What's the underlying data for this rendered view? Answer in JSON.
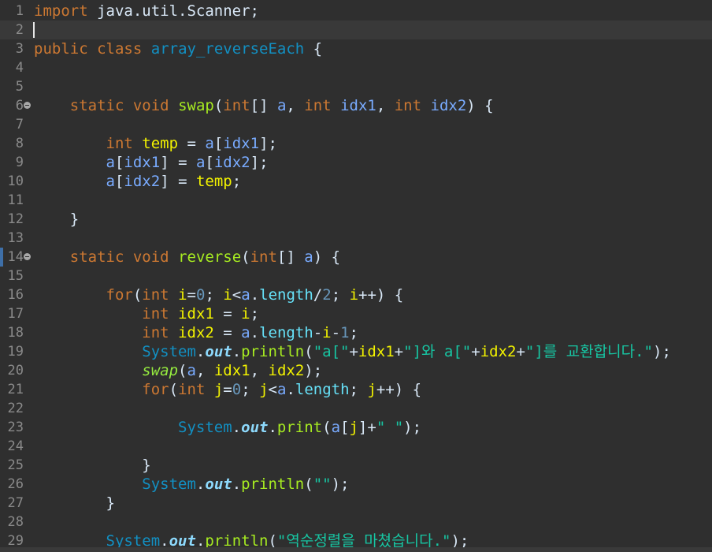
{
  "editor": {
    "current_line": 2,
    "lines": [
      {
        "n": "1",
        "tokens": [
          {
            "t": "import",
            "c": "kw"
          },
          {
            "t": " java.util.Scanner;",
            "c": "pl"
          }
        ]
      },
      {
        "n": "2",
        "tokens": []
      },
      {
        "n": "3",
        "tokens": [
          {
            "t": "public",
            "c": "kw"
          },
          {
            "t": " ",
            "c": "pl"
          },
          {
            "t": "class",
            "c": "kw"
          },
          {
            "t": " ",
            "c": "pl"
          },
          {
            "t": "array_reverseEach",
            "c": "cls"
          },
          {
            "t": " {",
            "c": "pl"
          }
        ]
      },
      {
        "n": "4",
        "tokens": []
      },
      {
        "n": "5",
        "tokens": []
      },
      {
        "n": "6",
        "fold": true,
        "tokens": [
          {
            "t": "    ",
            "c": "pl"
          },
          {
            "t": "static",
            "c": "kw"
          },
          {
            "t": " ",
            "c": "pl"
          },
          {
            "t": "void",
            "c": "kw"
          },
          {
            "t": " ",
            "c": "pl"
          },
          {
            "t": "swap",
            "c": "fn"
          },
          {
            "t": "(",
            "c": "pl"
          },
          {
            "t": "int",
            "c": "kw"
          },
          {
            "t": "[] ",
            "c": "pl"
          },
          {
            "t": "a",
            "c": "var"
          },
          {
            "t": ", ",
            "c": "pl"
          },
          {
            "t": "int",
            "c": "kw"
          },
          {
            "t": " ",
            "c": "pl"
          },
          {
            "t": "idx1",
            "c": "var"
          },
          {
            "t": ", ",
            "c": "pl"
          },
          {
            "t": "int",
            "c": "kw"
          },
          {
            "t": " ",
            "c": "pl"
          },
          {
            "t": "idx2",
            "c": "var"
          },
          {
            "t": ") {",
            "c": "pl"
          }
        ]
      },
      {
        "n": "7",
        "tokens": []
      },
      {
        "n": "8",
        "tokens": [
          {
            "t": "        ",
            "c": "pl"
          },
          {
            "t": "int",
            "c": "kw"
          },
          {
            "t": " ",
            "c": "pl"
          },
          {
            "t": "temp",
            "c": "loc"
          },
          {
            "t": " = ",
            "c": "pl"
          },
          {
            "t": "a",
            "c": "var"
          },
          {
            "t": "[",
            "c": "pl"
          },
          {
            "t": "idx1",
            "c": "var"
          },
          {
            "t": "];",
            "c": "pl"
          }
        ]
      },
      {
        "n": "9",
        "tokens": [
          {
            "t": "        ",
            "c": "pl"
          },
          {
            "t": "a",
            "c": "var"
          },
          {
            "t": "[",
            "c": "pl"
          },
          {
            "t": "idx1",
            "c": "var"
          },
          {
            "t": "] = ",
            "c": "pl"
          },
          {
            "t": "a",
            "c": "var"
          },
          {
            "t": "[",
            "c": "pl"
          },
          {
            "t": "idx2",
            "c": "var"
          },
          {
            "t": "];",
            "c": "pl"
          }
        ]
      },
      {
        "n": "10",
        "tokens": [
          {
            "t": "        ",
            "c": "pl"
          },
          {
            "t": "a",
            "c": "var"
          },
          {
            "t": "[",
            "c": "pl"
          },
          {
            "t": "idx2",
            "c": "var"
          },
          {
            "t": "] = ",
            "c": "pl"
          },
          {
            "t": "temp",
            "c": "loc"
          },
          {
            "t": ";",
            "c": "pl"
          }
        ]
      },
      {
        "n": "11",
        "tokens": []
      },
      {
        "n": "12",
        "tokens": [
          {
            "t": "    }",
            "c": "pl"
          }
        ]
      },
      {
        "n": "13",
        "tokens": []
      },
      {
        "n": "14",
        "fold": true,
        "marker": true,
        "tokens": [
          {
            "t": "    ",
            "c": "pl"
          },
          {
            "t": "static",
            "c": "kw"
          },
          {
            "t": " ",
            "c": "pl"
          },
          {
            "t": "void",
            "c": "kw"
          },
          {
            "t": " ",
            "c": "pl"
          },
          {
            "t": "reverse",
            "c": "fn"
          },
          {
            "t": "(",
            "c": "pl"
          },
          {
            "t": "int",
            "c": "kw"
          },
          {
            "t": "[] ",
            "c": "pl"
          },
          {
            "t": "a",
            "c": "var"
          },
          {
            "t": ") {",
            "c": "pl"
          }
        ]
      },
      {
        "n": "15",
        "tokens": []
      },
      {
        "n": "16",
        "tokens": [
          {
            "t": "        ",
            "c": "pl"
          },
          {
            "t": "for",
            "c": "kw"
          },
          {
            "t": "(",
            "c": "pl"
          },
          {
            "t": "int",
            "c": "kw"
          },
          {
            "t": " ",
            "c": "pl"
          },
          {
            "t": "i",
            "c": "loc"
          },
          {
            "t": "=",
            "c": "pl"
          },
          {
            "t": "0",
            "c": "num"
          },
          {
            "t": "; ",
            "c": "pl"
          },
          {
            "t": "i",
            "c": "loc"
          },
          {
            "t": "<",
            "c": "pl"
          },
          {
            "t": "a",
            "c": "var"
          },
          {
            "t": ".",
            "c": "pl"
          },
          {
            "t": "length",
            "c": "fld"
          },
          {
            "t": "/",
            "c": "pl"
          },
          {
            "t": "2",
            "c": "num"
          },
          {
            "t": "; ",
            "c": "pl"
          },
          {
            "t": "i",
            "c": "loc"
          },
          {
            "t": "++) {",
            "c": "pl"
          }
        ]
      },
      {
        "n": "17",
        "tokens": [
          {
            "t": "            ",
            "c": "pl"
          },
          {
            "t": "int",
            "c": "kw"
          },
          {
            "t": " ",
            "c": "pl"
          },
          {
            "t": "idx1",
            "c": "loc"
          },
          {
            "t": " = ",
            "c": "pl"
          },
          {
            "t": "i",
            "c": "loc"
          },
          {
            "t": ";",
            "c": "pl"
          }
        ]
      },
      {
        "n": "18",
        "tokens": [
          {
            "t": "            ",
            "c": "pl"
          },
          {
            "t": "int",
            "c": "kw"
          },
          {
            "t": " ",
            "c": "pl"
          },
          {
            "t": "idx2",
            "c": "loc"
          },
          {
            "t": " = ",
            "c": "pl"
          },
          {
            "t": "a",
            "c": "var"
          },
          {
            "t": ".",
            "c": "pl"
          },
          {
            "t": "length",
            "c": "fld"
          },
          {
            "t": "-",
            "c": "pl"
          },
          {
            "t": "i",
            "c": "loc"
          },
          {
            "t": "-",
            "c": "pl"
          },
          {
            "t": "1",
            "c": "num"
          },
          {
            "t": ";",
            "c": "pl"
          }
        ]
      },
      {
        "n": "19",
        "tokens": [
          {
            "t": "            ",
            "c": "pl"
          },
          {
            "t": "System",
            "c": "sys"
          },
          {
            "t": ".",
            "c": "pl"
          },
          {
            "t": "out",
            "c": "out"
          },
          {
            "t": ".",
            "c": "pl"
          },
          {
            "t": "println",
            "c": "mcall"
          },
          {
            "t": "(",
            "c": "pl"
          },
          {
            "t": "\"a[\"",
            "c": "str"
          },
          {
            "t": "+",
            "c": "pl"
          },
          {
            "t": "idx1",
            "c": "loc"
          },
          {
            "t": "+",
            "c": "pl"
          },
          {
            "t": "\"]와 a[\"",
            "c": "str"
          },
          {
            "t": "+",
            "c": "pl"
          },
          {
            "t": "idx2",
            "c": "loc"
          },
          {
            "t": "+",
            "c": "pl"
          },
          {
            "t": "\"]를 교환합니다.\"",
            "c": "str"
          },
          {
            "t": ");",
            "c": "pl"
          }
        ]
      },
      {
        "n": "20",
        "tokens": [
          {
            "t": "            ",
            "c": "pl"
          },
          {
            "t": "swap",
            "c": "mstatic"
          },
          {
            "t": "(",
            "c": "pl"
          },
          {
            "t": "a",
            "c": "var"
          },
          {
            "t": ", ",
            "c": "pl"
          },
          {
            "t": "idx1",
            "c": "loc"
          },
          {
            "t": ", ",
            "c": "pl"
          },
          {
            "t": "idx2",
            "c": "loc"
          },
          {
            "t": ");",
            "c": "pl"
          }
        ]
      },
      {
        "n": "21",
        "tokens": [
          {
            "t": "            ",
            "c": "pl"
          },
          {
            "t": "for",
            "c": "kw"
          },
          {
            "t": "(",
            "c": "pl"
          },
          {
            "t": "int",
            "c": "kw"
          },
          {
            "t": " ",
            "c": "pl"
          },
          {
            "t": "j",
            "c": "loc"
          },
          {
            "t": "=",
            "c": "pl"
          },
          {
            "t": "0",
            "c": "num"
          },
          {
            "t": "; ",
            "c": "pl"
          },
          {
            "t": "j",
            "c": "loc"
          },
          {
            "t": "<",
            "c": "pl"
          },
          {
            "t": "a",
            "c": "var"
          },
          {
            "t": ".",
            "c": "pl"
          },
          {
            "t": "length",
            "c": "fld"
          },
          {
            "t": "; ",
            "c": "pl"
          },
          {
            "t": "j",
            "c": "loc"
          },
          {
            "t": "++) {",
            "c": "pl"
          }
        ]
      },
      {
        "n": "22",
        "tokens": []
      },
      {
        "n": "23",
        "tokens": [
          {
            "t": "                ",
            "c": "pl"
          },
          {
            "t": "System",
            "c": "sys"
          },
          {
            "t": ".",
            "c": "pl"
          },
          {
            "t": "out",
            "c": "out"
          },
          {
            "t": ".",
            "c": "pl"
          },
          {
            "t": "print",
            "c": "mcall"
          },
          {
            "t": "(",
            "c": "pl"
          },
          {
            "t": "a",
            "c": "var"
          },
          {
            "t": "[",
            "c": "pl"
          },
          {
            "t": "j",
            "c": "loc"
          },
          {
            "t": "]+",
            "c": "pl"
          },
          {
            "t": "\" \"",
            "c": "str"
          },
          {
            "t": ");",
            "c": "pl"
          }
        ]
      },
      {
        "n": "24",
        "tokens": []
      },
      {
        "n": "25",
        "tokens": [
          {
            "t": "            }",
            "c": "pl"
          }
        ]
      },
      {
        "n": "26",
        "tokens": [
          {
            "t": "            ",
            "c": "pl"
          },
          {
            "t": "System",
            "c": "sys"
          },
          {
            "t": ".",
            "c": "pl"
          },
          {
            "t": "out",
            "c": "out"
          },
          {
            "t": ".",
            "c": "pl"
          },
          {
            "t": "println",
            "c": "mcall"
          },
          {
            "t": "(",
            "c": "pl"
          },
          {
            "t": "\"\"",
            "c": "str"
          },
          {
            "t": ");",
            "c": "pl"
          }
        ]
      },
      {
        "n": "27",
        "tokens": [
          {
            "t": "        }",
            "c": "pl"
          }
        ]
      },
      {
        "n": "28",
        "tokens": []
      },
      {
        "n": "29",
        "tokens": [
          {
            "t": "        ",
            "c": "pl"
          },
          {
            "t": "System",
            "c": "sys"
          },
          {
            "t": ".",
            "c": "pl"
          },
          {
            "t": "out",
            "c": "out"
          },
          {
            "t": ".",
            "c": "pl"
          },
          {
            "t": "println",
            "c": "mcall"
          },
          {
            "t": "(",
            "c": "pl"
          },
          {
            "t": "\"역순정렬을 마쳤습니다.\"",
            "c": "str"
          },
          {
            "t": ");",
            "c": "pl"
          }
        ]
      }
    ]
  }
}
